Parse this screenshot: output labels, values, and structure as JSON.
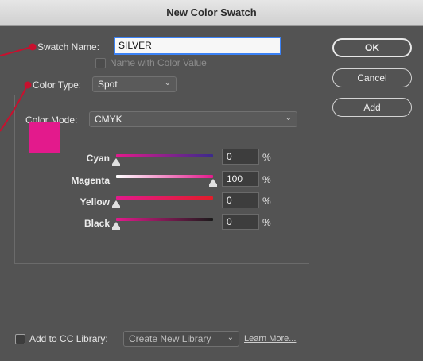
{
  "window": {
    "title": "New Color Swatch"
  },
  "form": {
    "swatch_name_label": "Swatch Name:",
    "swatch_name_value": "SILVER",
    "name_with_color_value_label": "Name with Color Value",
    "color_type_label": "Color Type:",
    "color_type_value": "Spot",
    "color_mode_label": "Color Mode:",
    "color_mode_value": "CMYK"
  },
  "preview_color": "#e31a8c",
  "sliders": [
    {
      "label": "Cyan",
      "value": "0",
      "unit": "%"
    },
    {
      "label": "Magenta",
      "value": "100",
      "unit": "%"
    },
    {
      "label": "Yellow",
      "value": "0",
      "unit": "%"
    },
    {
      "label": "Black",
      "value": "0",
      "unit": "%"
    }
  ],
  "buttons": {
    "ok": "OK",
    "cancel": "Cancel",
    "add": "Add"
  },
  "footer": {
    "add_to_cc_label": "Add to CC Library:",
    "library_value": "Create New Library",
    "learn_more": "Learn More..."
  },
  "annotation_color": "#c8102e"
}
